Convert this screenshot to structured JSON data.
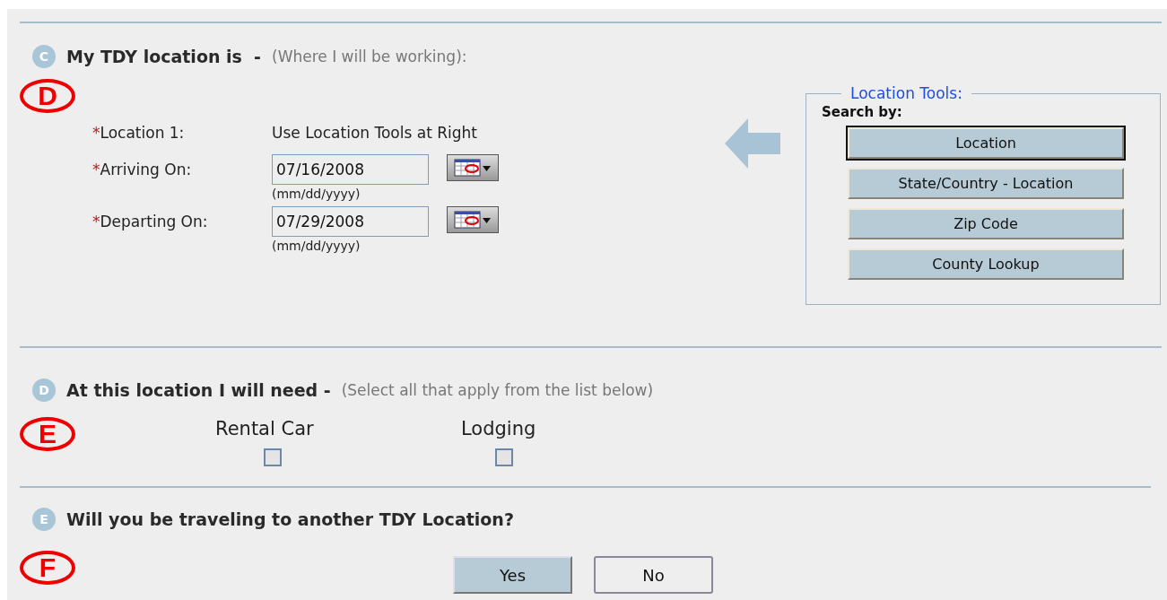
{
  "section_c": {
    "badge": "C",
    "title": "My TDY location is  -",
    "hint": "(Where I will be working):",
    "callout": "D",
    "location": {
      "required": "*",
      "label": "Location 1:",
      "value": "Use Location Tools at Right"
    },
    "dates": [
      {
        "required": "*",
        "label": "Arriving On:",
        "value": "07/16/2008",
        "format": "(mm/dd/yyyy)"
      },
      {
        "required": "*",
        "label": "Departing On:",
        "value": "07/29/2008",
        "format": "(mm/dd/yyyy)"
      }
    ],
    "location_tools": {
      "legend": "Location Tools:",
      "search_by": "Search by:",
      "buttons": [
        {
          "label": "Location",
          "selected": true
        },
        {
          "label": "State/Country - Location",
          "selected": false
        },
        {
          "label": "Zip Code",
          "selected": false
        },
        {
          "label": "County Lookup",
          "selected": false
        }
      ]
    }
  },
  "section_d": {
    "badge": "D",
    "title": "At this location I will need -",
    "hint": "(Select all that apply from the list below)",
    "callout": "E",
    "options": [
      {
        "label": "Rental Car",
        "checked": false
      },
      {
        "label": "Lodging",
        "checked": false
      }
    ]
  },
  "section_e": {
    "badge": "E",
    "title": "Will you be traveling to another TDY Location?",
    "callout": "F",
    "buttons": [
      {
        "label": "Yes",
        "selected": true
      },
      {
        "label": "No",
        "selected": false
      }
    ]
  }
}
